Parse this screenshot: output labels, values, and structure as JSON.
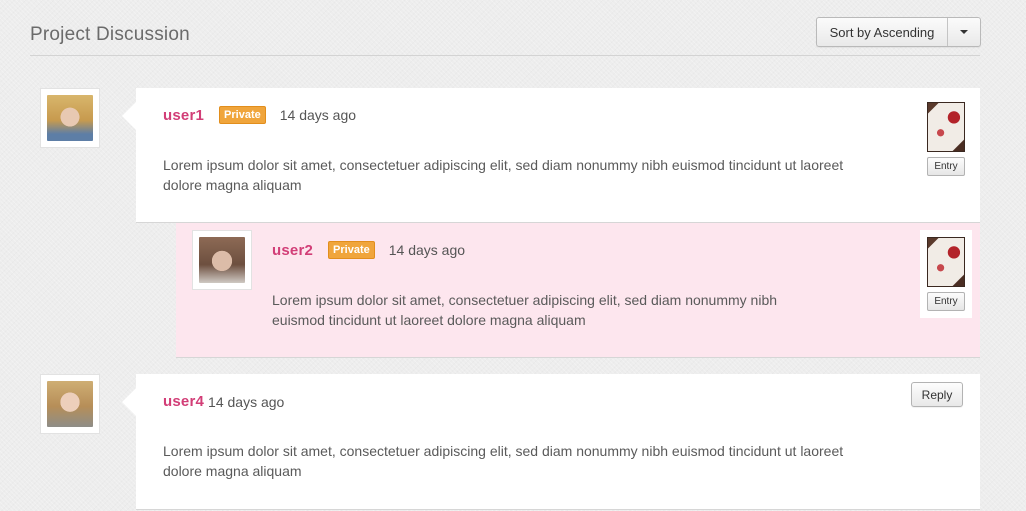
{
  "header": {
    "title": "Project Discussion",
    "sort_label": "Sort by Ascending",
    "sort_caret_icon": "caret-down-icon"
  },
  "comments": [
    {
      "user": "user1",
      "badge": "Private",
      "time": "14 days ago",
      "body": "Lorem ipsum dolor sit amet, consectetuer adipiscing elit, sed diam nonummy nibh euismod tincidunt ut laoreet dolore magna aliquam",
      "attachment_label": "Entry"
    },
    {
      "user": "user2",
      "badge": "Private",
      "time": "14 days ago",
      "body_line1": "Lorem ipsum dolor sit amet, consectetuer adipiscing elit, sed diam nonummy nibh",
      "body_line2": "euismod tincidunt ut laoreet dolore magna aliquam",
      "attachment_label": "Entry"
    },
    {
      "user": "user4",
      "time": "14 days ago",
      "body": "Lorem ipsum dolor sit amet, consectetuer adipiscing elit, sed diam nonummy nibh euismod tincidunt ut laoreet dolore magna aliquam",
      "reply_label": "Reply"
    }
  ],
  "colors": {
    "username": "#d23e77",
    "badge": "#f0a53c",
    "nested_background": "#fde6ee"
  }
}
